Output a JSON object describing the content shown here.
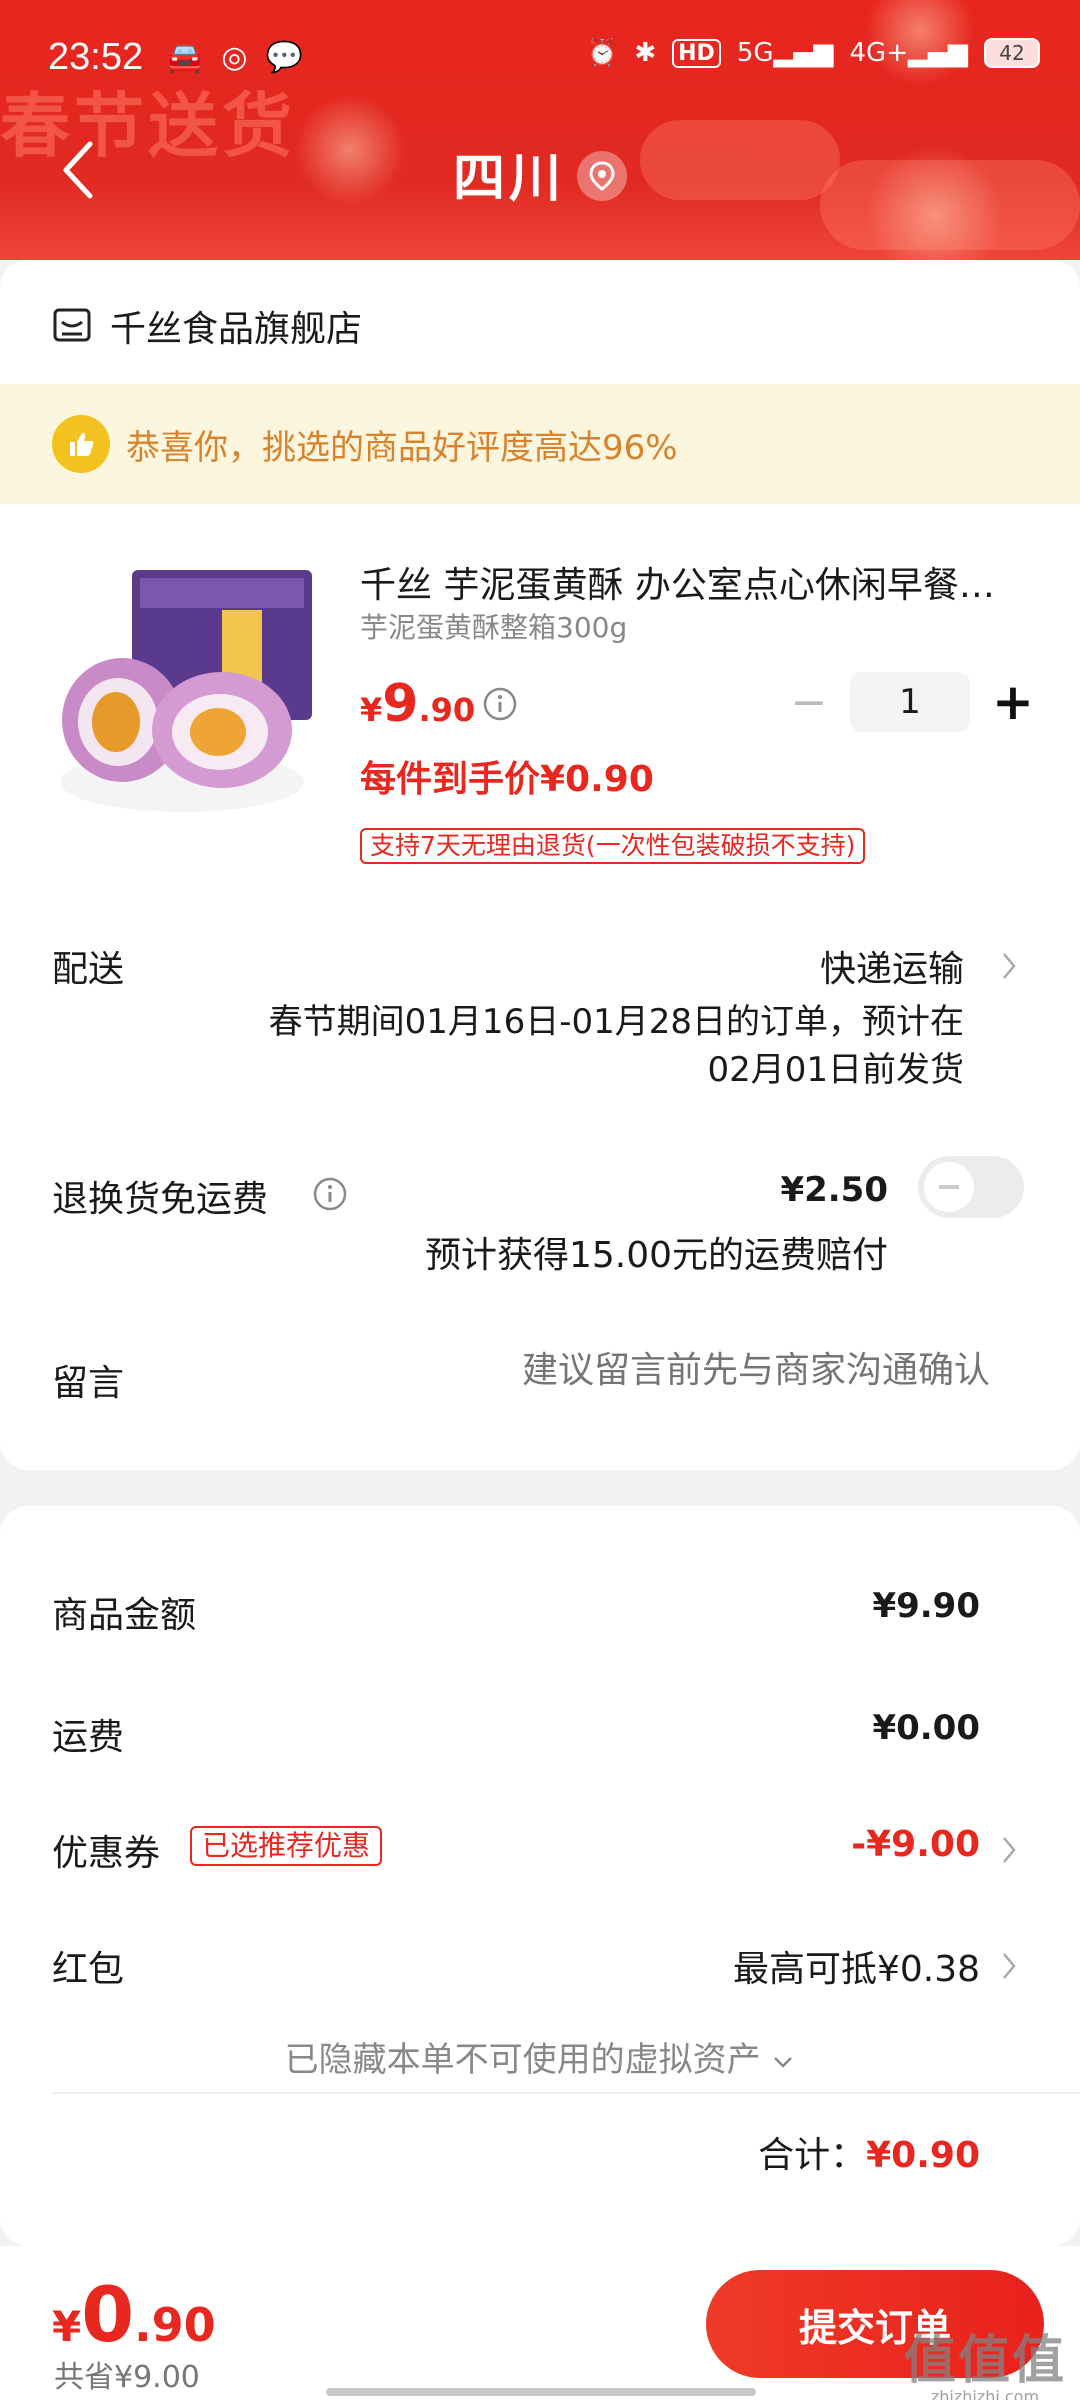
{
  "status_bar": {
    "time": "23:52",
    "battery": "42",
    "hd": "HD",
    "net1": "5G",
    "net2": "4G+"
  },
  "header": {
    "deco_text": "春节送货",
    "region": "四川"
  },
  "shop": {
    "name": "千丝食品旗舰店"
  },
  "praise_banner": {
    "text": "恭喜你，挑选的商品好评度高达96%"
  },
  "product": {
    "title": "千丝 芋泥蛋黄酥 办公室点心休闲早餐糕点",
    "spec": "芋泥蛋黄酥整箱300g",
    "price_currency": "¥",
    "price_int": "9",
    "price_dec": ".90",
    "quantity": "1",
    "unit_price": "每件到手价¥0.90",
    "return_badge": "支持7天无理由退货(一次性包装破损不支持)"
  },
  "delivery": {
    "label": "配送",
    "value": "快递运输",
    "note_line1": "春节期间01月16日-01月28日的订单，预计在",
    "note_line2": "02月01日前发货"
  },
  "return_fee": {
    "label": "退换货免运费",
    "amount": "¥2.50",
    "note": "预计获得15.00元的运费赔付",
    "enabled": false
  },
  "message": {
    "label": "留言",
    "placeholder": "建议留言前先与商家沟通确认"
  },
  "summary": {
    "goods_label": "商品金额",
    "goods_value": "¥9.90",
    "shipping_label": "运费",
    "shipping_value": "¥0.00",
    "coupon_label": "优惠券",
    "coupon_tag": "已选推荐优惠",
    "coupon_value": "-¥9.00",
    "redpacket_label": "红包",
    "redpacket_value": "最高可抵¥0.38",
    "hidden_assets": "已隐藏本单不可使用的虚拟资产",
    "total_label": "合计：",
    "total_value": "¥0.90"
  },
  "bottom_bar": {
    "price_currency": "¥",
    "price_int": "0",
    "price_dec": ".90",
    "saved": "共省¥9.00",
    "submit_label": "提交订单"
  },
  "watermark": {
    "main": "值值值",
    "sub": "zhizhizhi.com"
  },
  "colors": {
    "accent": "#e8271f",
    "header": "#e8251e",
    "praise_bg": "#fdf6de",
    "praise_text": "#d9822b"
  }
}
